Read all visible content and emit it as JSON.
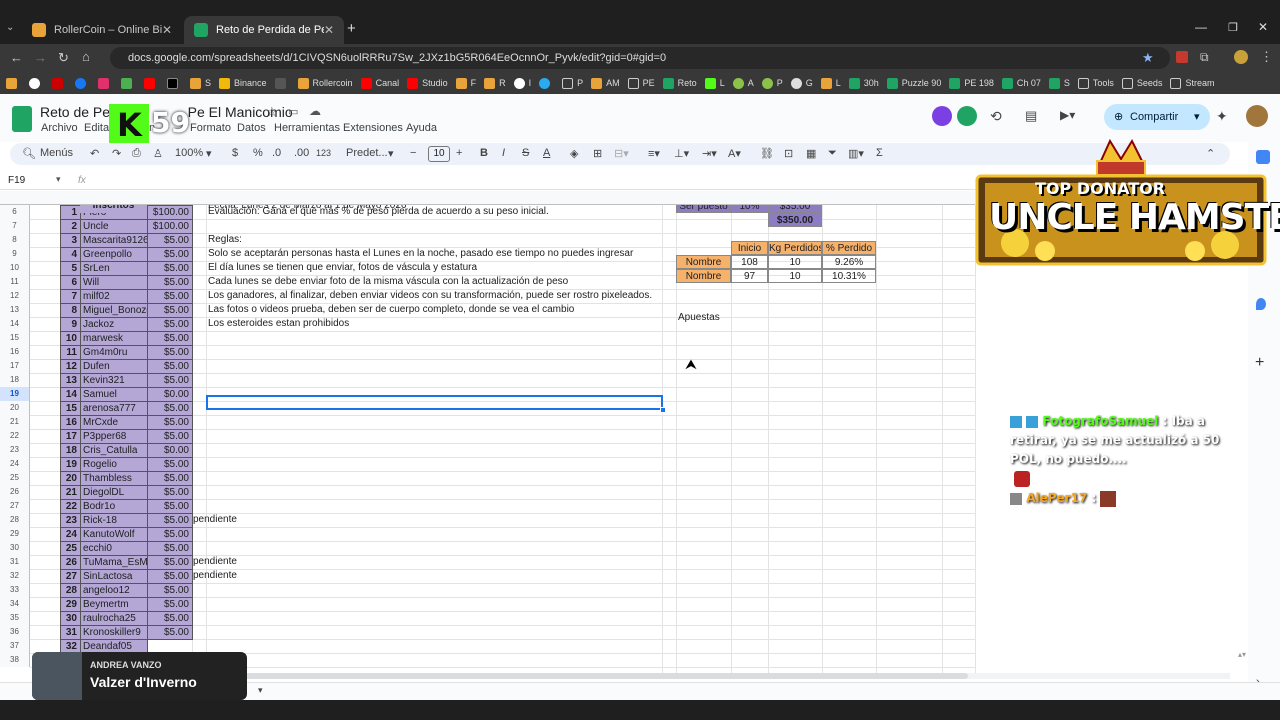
{
  "browser": {
    "tabs": [
      {
        "title": "RollerCoin – Online Bitcoin Min",
        "active": false
      },
      {
        "title": "Reto de Perdida de Peso - El M",
        "active": true
      }
    ],
    "url": "docs.google.com/spreadsheets/d/1CIVQSN6uolRRRu7Sw_2JXz1bG5R064EeOcnnOr_Pyvk/edit?gid=0#gid=0",
    "bookmarks": [
      "S",
      "Binance",
      "Rollercoin",
      "Canal",
      "Studio",
      "F",
      "R",
      "I",
      "P",
      "AM",
      "PE",
      "Reto",
      "L",
      "A",
      "P",
      "G",
      "L",
      "30h",
      "Puzzle 90",
      "PE 198",
      "Ch 07",
      "S",
      "Tools",
      "Seeds",
      "Stream"
    ]
  },
  "sheets": {
    "title": "Reto de Perdida de Peso - El Manicomio",
    "title_visible": "Reto de Perdi",
    "title_tail": "Pe    El Manicomio",
    "menus": [
      "Archivo",
      "Editar",
      "In",
      "Formato",
      "Datos",
      "Herramientas",
      "Extensiones",
      "Ayuda"
    ],
    "share_label": "Compartir",
    "toolbar": {
      "menus": "Menús",
      "zoom": "100%",
      "currency": "$",
      "percent": "%",
      "dec_less": ".0",
      "dec_more": ".00",
      "format_123": "123",
      "font": "Predet...",
      "font_size": "10"
    },
    "name_box": "F19",
    "fx": "fx"
  },
  "grid": {
    "columns": [
      "A",
      "B",
      "C",
      "D",
      "E",
      "F",
      "G",
      "H",
      "I",
      "J",
      "K",
      "L"
    ],
    "row_numbers": [
      "6",
      "7",
      "8",
      "9",
      "10",
      "11",
      "12",
      "13",
      "14",
      "15",
      "16",
      "17",
      "18",
      "19",
      "20",
      "21",
      "22",
      "23",
      "24",
      "25",
      "26",
      "27",
      "28",
      "29",
      "30",
      "31",
      "32",
      "33",
      "34",
      "35",
      "36",
      "37",
      "38"
    ],
    "partial_top": {
      "b_header": "Inscritos",
      "f_text": "Fecha: Lunes 2 de Marzo al 1 de Mayo 2026",
      "h_label": "Ser puesto",
      "i_val": "10%",
      "j_val": "$35.00"
    },
    "participants": [
      {
        "n": "1",
        "name": "Piero",
        "amt": "$100.00"
      },
      {
        "n": "2",
        "name": "Uncle",
        "amt": "$100.00"
      },
      {
        "n": "3",
        "name": "Mascarita9126",
        "amt": "$5.00"
      },
      {
        "n": "4",
        "name": "Greenpollo",
        "amt": "$5.00"
      },
      {
        "n": "5",
        "name": "SrLen",
        "amt": "$5.00"
      },
      {
        "n": "6",
        "name": "Will",
        "amt": "$5.00"
      },
      {
        "n": "7",
        "name": "milf02",
        "amt": "$5.00"
      },
      {
        "n": "8",
        "name": "Miguel_Bonozo",
        "amt": "$5.00"
      },
      {
        "n": "9",
        "name": "Jackoz",
        "amt": "$5.00"
      },
      {
        "n": "10",
        "name": "marwesk",
        "amt": "$5.00"
      },
      {
        "n": "11",
        "name": "Gm4m0ru",
        "amt": "$5.00"
      },
      {
        "n": "12",
        "name": "Dufen",
        "amt": "$5.00"
      },
      {
        "n": "13",
        "name": "Kevin321",
        "amt": "$5.00"
      },
      {
        "n": "14",
        "name": "Samuel",
        "amt": "$0.00"
      },
      {
        "n": "15",
        "name": "arenosa777",
        "amt": "$5.00"
      },
      {
        "n": "16",
        "name": "MrCxde",
        "amt": "$5.00"
      },
      {
        "n": "17",
        "name": "P3pper68",
        "amt": "$5.00"
      },
      {
        "n": "18",
        "name": "Cris_Catulla",
        "amt": "$0.00"
      },
      {
        "n": "19",
        "name": "Rogelio",
        "amt": "$5.00"
      },
      {
        "n": "20",
        "name": "Thambless",
        "amt": "$5.00"
      },
      {
        "n": "21",
        "name": "DiegolDL",
        "amt": "$5.00"
      },
      {
        "n": "22",
        "name": "Bodr1o",
        "amt": "$5.00"
      },
      {
        "n": "23",
        "name": "Rick-18",
        "amt": "$5.00"
      },
      {
        "n": "24",
        "name": "KanutoWolf",
        "amt": "$5.00"
      },
      {
        "n": "25",
        "name": "ecchi0",
        "amt": "$5.00"
      },
      {
        "n": "26",
        "name": "TuMama_EsMiN",
        "amt": "$5.00"
      },
      {
        "n": "27",
        "name": "SinLactosa",
        "amt": "$5.00"
      },
      {
        "n": "28",
        "name": "angeloo12",
        "amt": "$5.00"
      },
      {
        "n": "29",
        "name": "Beymertm",
        "amt": "$5.00"
      },
      {
        "n": "30",
        "name": "raulrocha25",
        "amt": "$5.00"
      },
      {
        "n": "31",
        "name": "Kronoskiller9",
        "amt": "$5.00"
      },
      {
        "n": "32",
        "name": "Deandaf05",
        "amt": ""
      }
    ],
    "pending": {
      "row28": "pendiente",
      "row31": "pendiente",
      "row32": "pendiente"
    },
    "rules": [
      "Evaluación: Gana el que más % de peso pierda de acuerdo a su peso inicial.",
      "",
      "Reglas:",
      "Solo se aceptarán personas hasta el Lunes en la noche, pasado ese tiempo no puedes ingresar",
      "El día lunes se tienen que enviar, fotos de váscula y estatura",
      "Cada lunes se debe enviar foto de la misma váscula con la actualización de peso",
      "Los ganadores, al finalizar, deben enviar videos con su transformación, puede ser rostro pixeleados.",
      "Las fotos o videos prueba, deben ser de cuerpo completo, donde se vea el cambio",
      "Los esteroides estan prohibidos"
    ],
    "total": "$350.00",
    "weights": {
      "headers": [
        "Inicio",
        "Kg Perdidos",
        "% Perdido"
      ],
      "rows": [
        {
          "label": "Nombre",
          "inicio": "108",
          "kg": "10",
          "pct": "9.26%"
        },
        {
          "label": "Nombre",
          "inicio": "97",
          "kg": "10",
          "pct": "10.31%"
        }
      ]
    },
    "apuestas": "Apuestas",
    "sheet_tab_tail": "s"
  },
  "overlays": {
    "kick_number": "59",
    "donator_top": "TOP DONATOR",
    "donator_name": "UNCLE HAMSTER",
    "chat": [
      {
        "user": "FotografoSamuel",
        "text": ": Iba a retirar, ya se me actualizó a 50 POL, no puedo...."
      },
      {
        "user": "AlePer17",
        "text": ":"
      }
    ],
    "music_artist": "ANDREA VANZO",
    "music_title": "Valzer d'Inverno"
  },
  "colors": {
    "purple": "#b4a7d6",
    "orange": "#f6b26b",
    "selection": "#1a73e8"
  }
}
